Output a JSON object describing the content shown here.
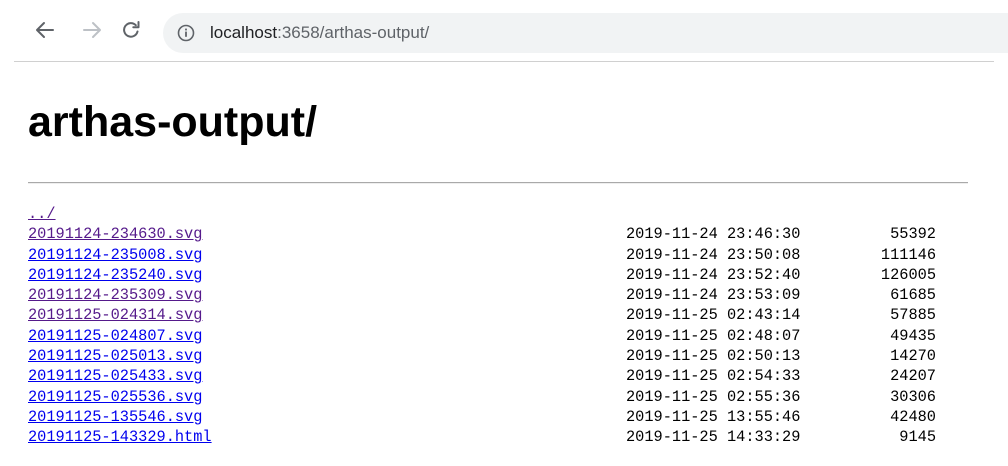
{
  "browser": {
    "url_host": "localhost",
    "url_rest": ":3658/arthas-output/"
  },
  "page": {
    "title": "arthas-output/",
    "parent_link": "../"
  },
  "files": [
    {
      "name": "20191124-234630.svg",
      "date": "2019-11-24 23:46:30",
      "size": "55392",
      "visited": true
    },
    {
      "name": "20191124-235008.svg",
      "date": "2019-11-24 23:50:08",
      "size": "111146",
      "visited": false
    },
    {
      "name": "20191124-235240.svg",
      "date": "2019-11-24 23:52:40",
      "size": "126005",
      "visited": false
    },
    {
      "name": "20191124-235309.svg",
      "date": "2019-11-24 23:53:09",
      "size": "61685",
      "visited": true
    },
    {
      "name": "20191125-024314.svg",
      "date": "2019-11-25 02:43:14",
      "size": "57885",
      "visited": true
    },
    {
      "name": "20191125-024807.svg",
      "date": "2019-11-25 02:48:07",
      "size": "49435",
      "visited": false
    },
    {
      "name": "20191125-025013.svg",
      "date": "2019-11-25 02:50:13",
      "size": "14270",
      "visited": false
    },
    {
      "name": "20191125-025433.svg",
      "date": "2019-11-25 02:54:33",
      "size": "24207",
      "visited": false
    },
    {
      "name": "20191125-025536.svg",
      "date": "2019-11-25 02:55:36",
      "size": "30306",
      "visited": false
    },
    {
      "name": "20191125-135546.svg",
      "date": "2019-11-25 13:55:46",
      "size": "42480",
      "visited": false
    },
    {
      "name": "20191125-143329.html",
      "date": "2019-11-25 14:33:29",
      "size": "9145",
      "visited": false
    }
  ],
  "colors": {
    "link": "#0000ee",
    "link_visited": "#551a8b",
    "omnibox_bg": "#f1f3f4"
  },
  "icons": {
    "back": "arrow-left-icon",
    "forward": "arrow-right-icon",
    "reload": "reload-icon",
    "site_info": "info-circle-icon"
  }
}
